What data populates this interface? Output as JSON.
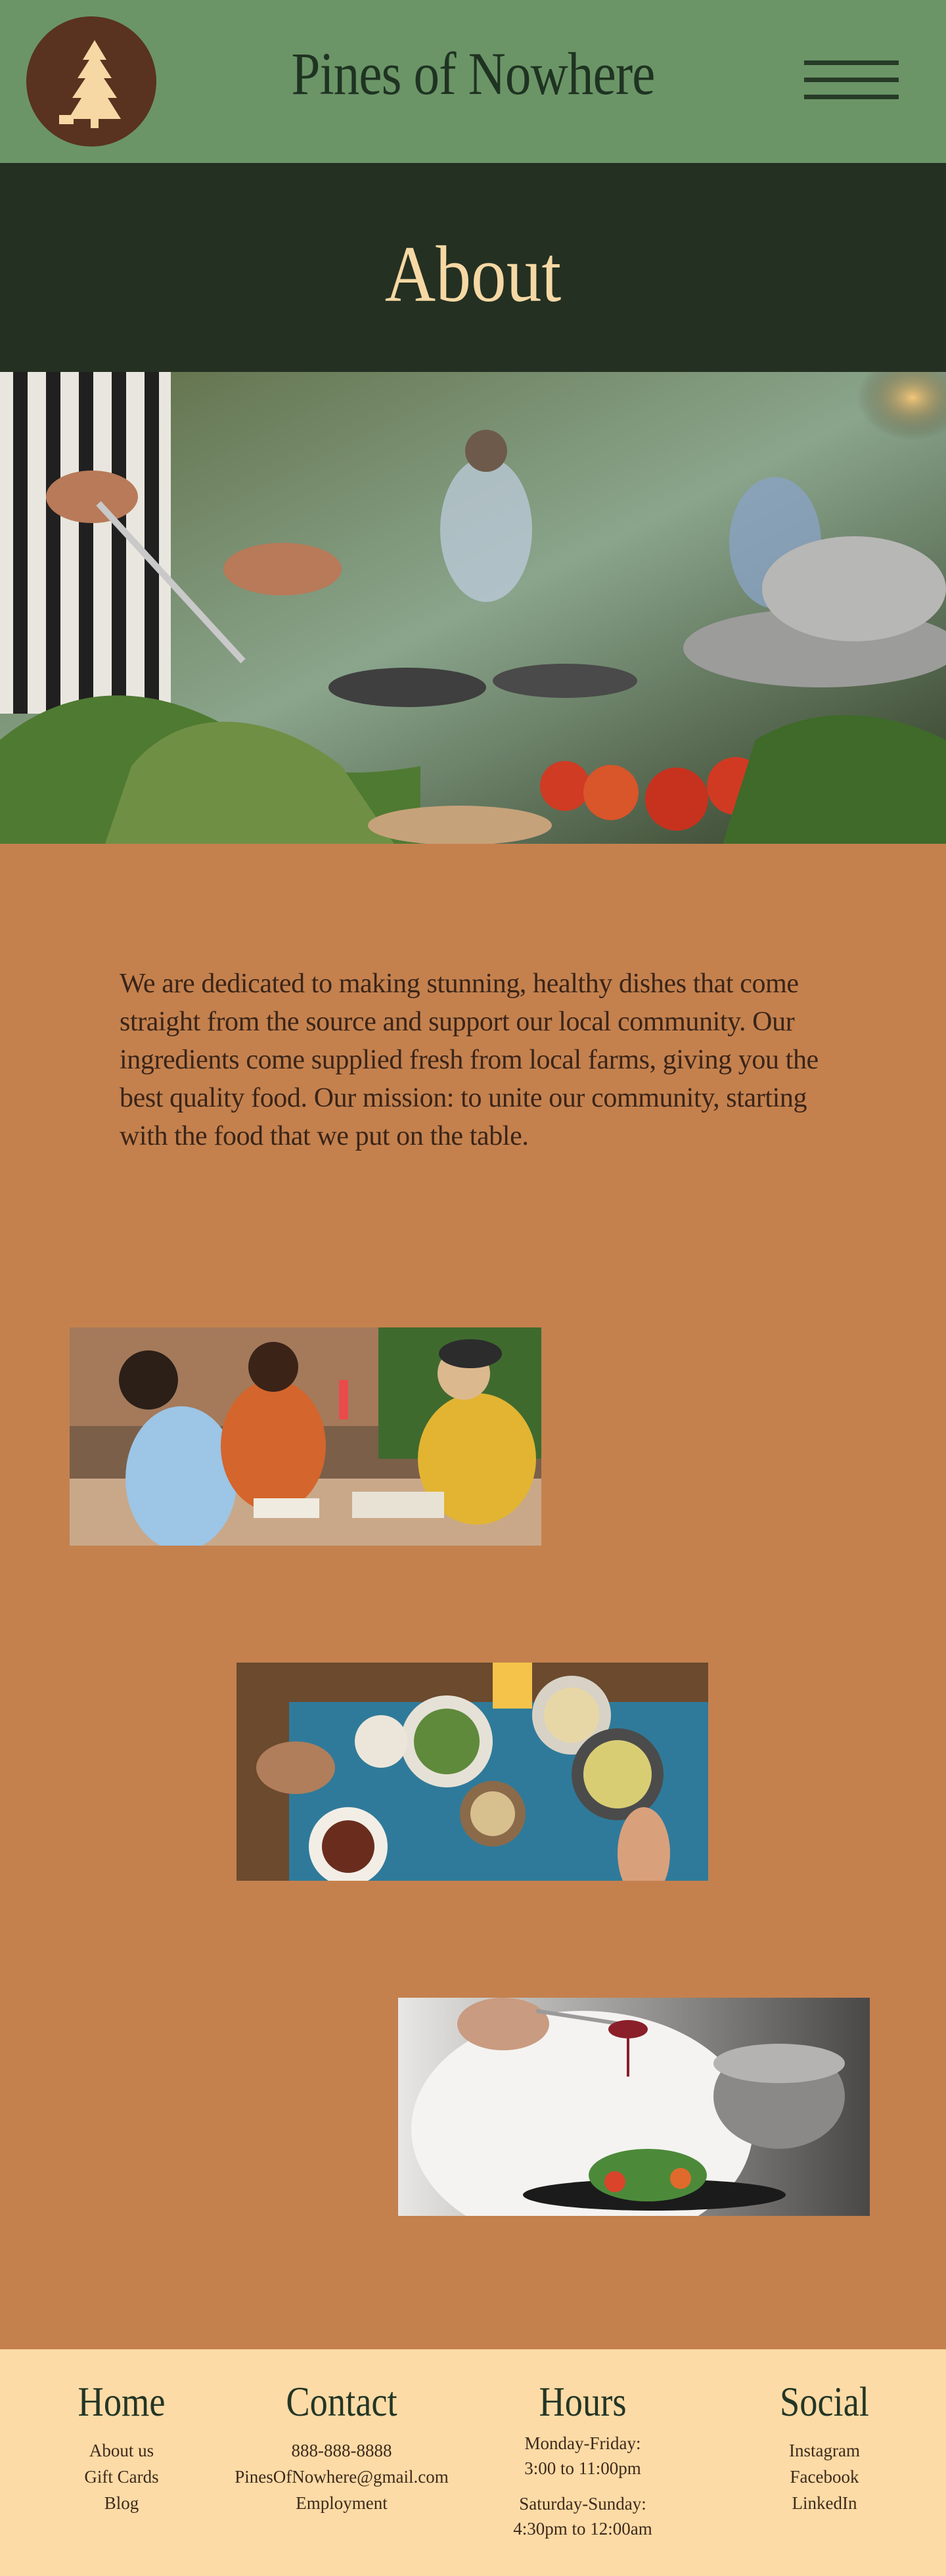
{
  "header": {
    "site_title": "Pines of Nowhere",
    "logo_icon": "pine-tree-icon",
    "menu_icon": "hamburger-menu-icon"
  },
  "banner": {
    "title": "About"
  },
  "intro": {
    "text": "We are dedicated to making stunning, healthy dishes that come straight from the source and support our local community. Our ingredients come supplied fresh from local farms, giving you the best quality food. Our mission: to unite our community, starting with the food that we put on the table."
  },
  "images": {
    "hero": "chefs preparing fresh vegetables in a restaurant kitchen",
    "photo_1": "friends toasting drinks over pizza",
    "photo_2": "shared table of dishes seen from above",
    "photo_3": "chef drizzling sauce over a plated salad"
  },
  "footer": {
    "home": {
      "heading": "Home",
      "links": [
        "About us",
        "Gift Cards",
        "Blog"
      ]
    },
    "contact": {
      "heading": "Contact",
      "phone": "888-888-8888",
      "email": "PinesOfNowhere@gmail.com",
      "employment": "Employment"
    },
    "hours": {
      "heading": "Hours",
      "weekday_label": "Monday-Friday:",
      "weekday_time": "3:00 to 11:00pm",
      "weekend_label": "Saturday-Sunday:",
      "weekend_time": "4:30pm to 12:00am"
    },
    "social": {
      "heading": "Social",
      "links": [
        "Instagram",
        "Facebook",
        "LinkedIn"
      ]
    }
  },
  "colors": {
    "header_bg": "#6b9567",
    "banner_bg": "#243022",
    "body_bg": "#c4814e",
    "footer_bg": "#fddba6",
    "logo_bg": "#5a3220",
    "accent_text": "#f6d8a4"
  }
}
